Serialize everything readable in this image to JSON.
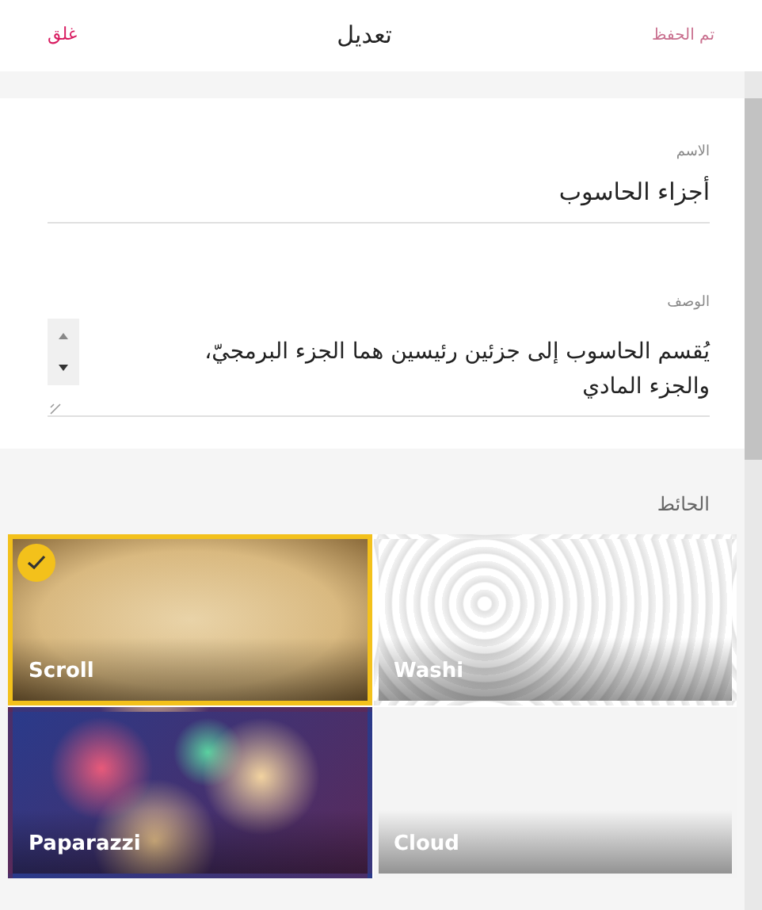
{
  "header": {
    "save_label": "تم الحفظ",
    "save_disabled": true,
    "title": "تعديل",
    "close_label": "غلق"
  },
  "form": {
    "name": {
      "label": "الاسم",
      "value": "أجزاء الحاسوب"
    },
    "description": {
      "label": "الوصف",
      "value": "يُقسم الحاسوب إلى جزئين رئيسين هما الجزء البرمجيّ، والجزء المادي"
    }
  },
  "wall": {
    "label": "الحائط",
    "tiles": [
      {
        "name": "Washi",
        "kind": "pattern",
        "selected": false
      },
      {
        "name": "Scroll",
        "kind": "parchment",
        "selected": true
      },
      {
        "name": "Cloud",
        "kind": "plain",
        "selected": false
      },
      {
        "name": "Paparazzi",
        "kind": "bokeh",
        "selected": false
      }
    ]
  }
}
